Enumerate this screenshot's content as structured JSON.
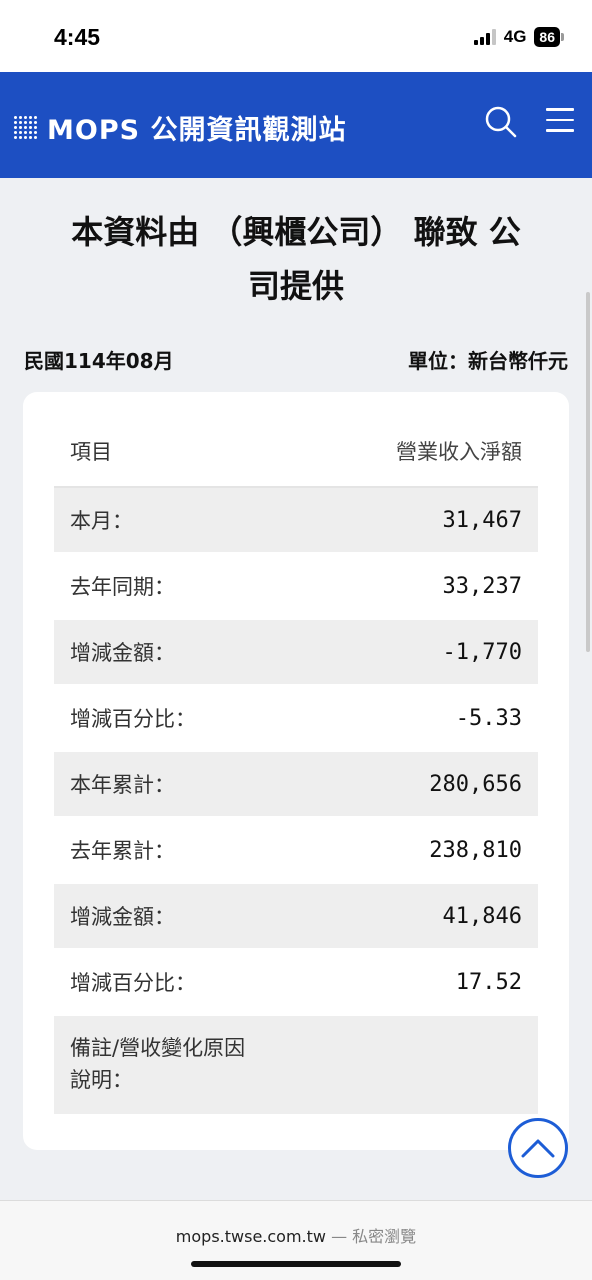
{
  "status_bar": {
    "time": "4:45",
    "network": "4G",
    "battery": "86"
  },
  "header": {
    "logo_text": "MOPS 公開資訊觀測站",
    "search_icon": "search-icon",
    "menu_icon": "hamburger-menu-icon",
    "brand_color": "#1d4fc2"
  },
  "page": {
    "title_line1": "本資料由 （興櫃公司） 聯致 公",
    "title_line2": "司提供",
    "period": "民國114年08月",
    "unit": "單位：新台幣仟元"
  },
  "table": {
    "header": {
      "label": "項目",
      "value": "營業收入淨額"
    },
    "rows": [
      {
        "label": "本月：",
        "value": "31,467"
      },
      {
        "label": "去年同期：",
        "value": "33,237"
      },
      {
        "label": "增減金額：",
        "value": "-1,770"
      },
      {
        "label": "增減百分比：",
        "value": "-5.33"
      },
      {
        "label": "本年累計：",
        "value": "280,656"
      },
      {
        "label": "去年累計：",
        "value": "238,810"
      },
      {
        "label": "增減金額：",
        "value": "41,846"
      },
      {
        "label": "增減百分比：",
        "value": "17.52"
      }
    ],
    "note": {
      "label_line1": "備註/營收變化原因",
      "label_line2": "說明：",
      "value": ""
    }
  },
  "back_to_top": {
    "icon": "chevron-up-icon"
  },
  "browser": {
    "url": "mops.twse.com.tw",
    "separator": " — ",
    "mode": "私密瀏覽"
  }
}
